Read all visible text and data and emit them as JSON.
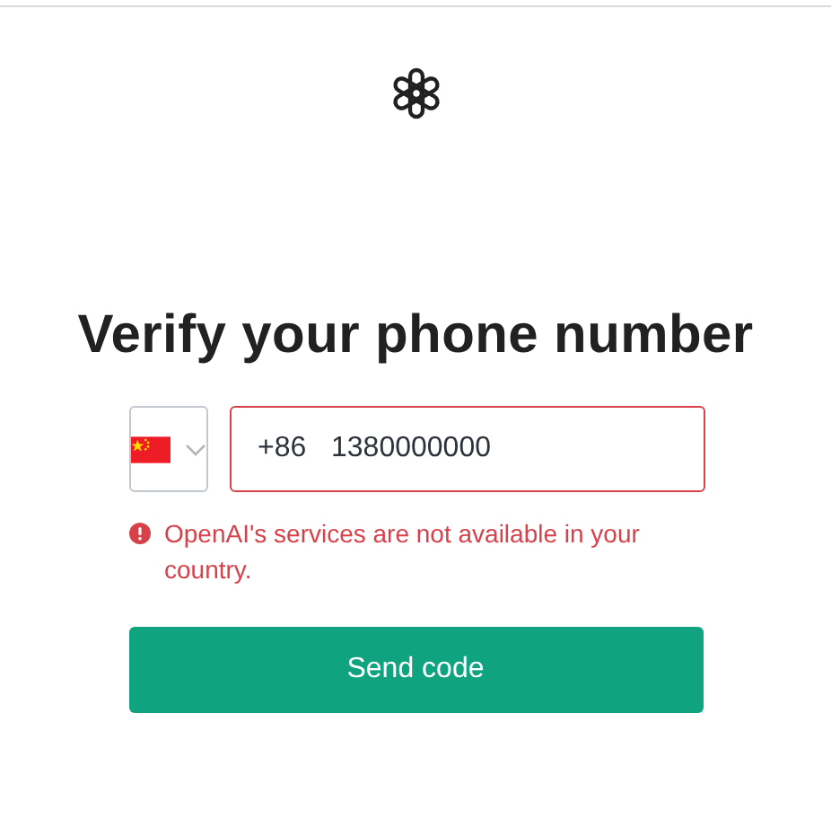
{
  "heading": "Verify your phone number",
  "phone": {
    "prefix": "+86",
    "value": "1380000000",
    "invalid": true
  },
  "error": "OpenAI's services are not available in your country.",
  "button": "Send code"
}
